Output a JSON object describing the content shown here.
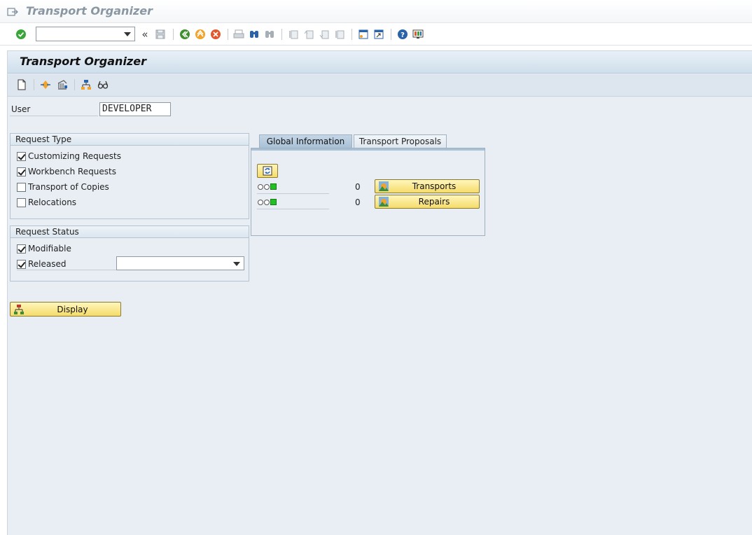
{
  "window": {
    "title": "Transport Organizer"
  },
  "toolbar": {
    "command_field_value": "",
    "icons": [
      "enter-icon",
      "command-history-icon",
      "save-icon",
      "back-icon",
      "exit-icon",
      "cancel-icon",
      "print-icon",
      "find-icon",
      "find-next-icon",
      "first-page-icon",
      "previous-page-icon",
      "next-page-icon",
      "last-page-icon",
      "new-session-icon",
      "shortcut-icon",
      "help-icon",
      "customize-layout-icon"
    ],
    "history_glyph": "«"
  },
  "screen": {
    "title": "Transport Organizer",
    "app_icons": [
      "create-document-icon",
      "display-request-icon",
      "transport-request-icon",
      "hierarchy-icon",
      "glasses-icon"
    ]
  },
  "user": {
    "label": "User",
    "value": "DEVELOPER"
  },
  "request_type": {
    "title": "Request Type",
    "options": [
      {
        "label": "Customizing Requests",
        "checked": true
      },
      {
        "label": "Workbench Requests",
        "checked": true
      },
      {
        "label": "Transport of Copies",
        "checked": false
      },
      {
        "label": "Relocations",
        "checked": false
      }
    ]
  },
  "request_status": {
    "title": "Request Status",
    "modifiable": {
      "label": "Modifiable",
      "checked": true
    },
    "released": {
      "label": "Released",
      "checked": true,
      "date_value": ""
    }
  },
  "display_button": {
    "label": "Display"
  },
  "tabs": [
    {
      "label": "Global Information",
      "active": true
    },
    {
      "label": "Transport Proposals",
      "active": false
    }
  ],
  "global_info": {
    "rows": [
      {
        "count": "0",
        "button_label": "Transports",
        "status": "green"
      },
      {
        "count": "0",
        "button_label": "Repairs",
        "status": "green"
      }
    ]
  },
  "colors": {
    "background": "#e8eef4",
    "button_yellow": "#f5dc6a",
    "status_green": "#22c022",
    "header_blue": "#cfdfec"
  }
}
